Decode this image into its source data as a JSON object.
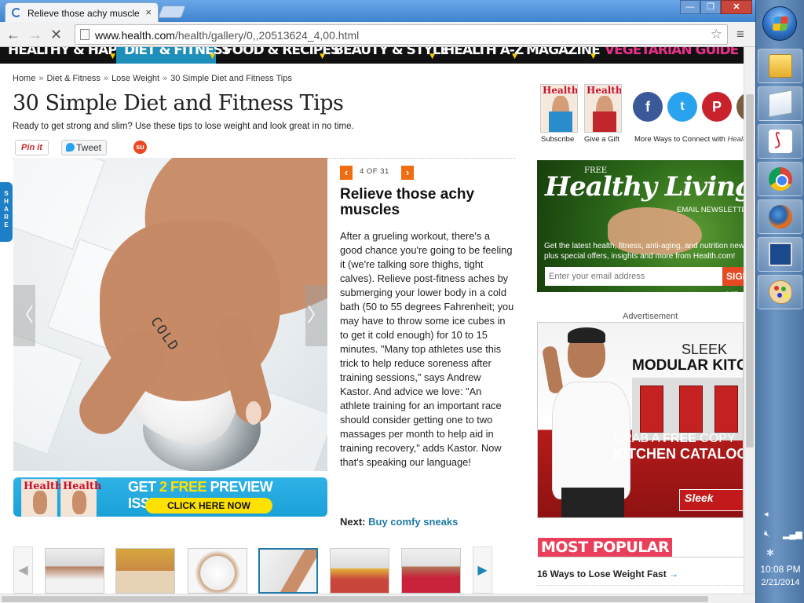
{
  "browser": {
    "tab_title": "Relieve those achy muscle",
    "tab_close": "×",
    "url_host": "www.health.com",
    "url_path": "/health/gallery/0,,20513624_4,00.html",
    "window_min": "—",
    "window_max": "❐",
    "window_close": "✕",
    "back": "←",
    "forward": "→",
    "reload": "✕",
    "star": "☆",
    "menu": "≡"
  },
  "site_nav": {
    "items": [
      {
        "label": "HEALTHY & HAPPY",
        "active": false
      },
      {
        "label": "DIET & FITNESS",
        "active": true
      },
      {
        "label": "FOOD & RECIPES",
        "active": false
      },
      {
        "label": "BEAUTY & STYLE",
        "active": false
      },
      {
        "label": "HEALTH A-Z",
        "active": false
      },
      {
        "label": "MAGAZINE",
        "active": false
      },
      {
        "label": "VEGETARIAN GUIDE",
        "active": false
      }
    ],
    "dropdown_arrow": "▼"
  },
  "breadcrumb": {
    "items": [
      "Home",
      "Diet & Fitness",
      "Lose Weight",
      "30 Simple Diet and Fitness Tips"
    ],
    "separator": "»"
  },
  "page": {
    "title": "30 Simple Diet and Fitness Tips",
    "subtitle": "Ready to get strong and slim? Use these tips to lose weight and look great in no time."
  },
  "share": {
    "pinit": "Pin it",
    "tweet": "Tweet",
    "stumble": "su",
    "side_tab": "SHARE"
  },
  "slide": {
    "counter": "4 OF 31",
    "prev": "‹",
    "next": "›",
    "title": "Relieve those achy muscles",
    "body": "After a grueling workout, there's a good chance you're going to be feeling it (we're talking sore thighs, tight calves). Relieve post-fitness aches by submerging your lower body in a cold bath (50 to 55 degrees Fahrenheit; you may have to throw some ice cubes in to get it cold enough) for 10 to 15 minutes. \"Many top athletes use this trick to help reduce soreness after training sessions,\" says Andrew Kastor. And advice we love: \"An athlete training for an important race should consider getting one to two massages per month to help aid in training recovery,\" adds Kastor. Now that's speaking our language!",
    "next_label": "Next:",
    "next_link": "Buy comfy sneaks",
    "image_text": "COLD",
    "image_prev": "〈",
    "image_next": "〉"
  },
  "preview_banner": {
    "headline_pre": "GET",
    "headline_num": "2 FREE",
    "headline_post": "PREVIEW ISSUES!",
    "cta": "CLICK HERE NOW",
    "cover_logo": "Health"
  },
  "thumb_strip": {
    "prev": "◀",
    "next": "▶",
    "count": 6,
    "active_index": 3
  },
  "right_column": {
    "subscribe": "Subscribe",
    "give_gift": "Give a Gift",
    "more_ways": "More Ways to Connect with",
    "more_ways_brand": "Health",
    "cover_logo": "Health",
    "social": {
      "facebook": "f",
      "twitter": "t",
      "pinterest": "P"
    },
    "newsletter": {
      "free": "FREE",
      "title": "Healthy Living",
      "subtitle": "EMAIL NEWSLETTER",
      "desc_line1": "Get the latest health, fitness, anti-aging, and nutrition news,",
      "desc_line2": "plus special offers, insights and more from Health.com!",
      "placeholder": "Enter your email address",
      "button": "SIGN UP"
    },
    "ad_label": "Advertisement",
    "ad": {
      "line1": "SLEEK",
      "line2": "MODULAR KITCHENS",
      "grab_pre": "GRAB A",
      "grab_free": "FREE",
      "grab_post": "COPY",
      "catalog": "KITCHEN CATALOG",
      "logo": "Sleek"
    },
    "most_popular": "MOST POPULAR",
    "most_popular_item": "16 Ways to Lose Weight Fast",
    "most_popular_arrow": "→"
  },
  "taskbar": {
    "chevron": "◂",
    "time": "10:08 PM",
    "date": "2/21/2014",
    "bluetooth": "✱"
  },
  "colors": {
    "nav_active": "#1e8fb8",
    "accent_orange": "#ef6c11",
    "link_blue": "#1f7aa7",
    "most_popular": "#ea3f5a"
  }
}
